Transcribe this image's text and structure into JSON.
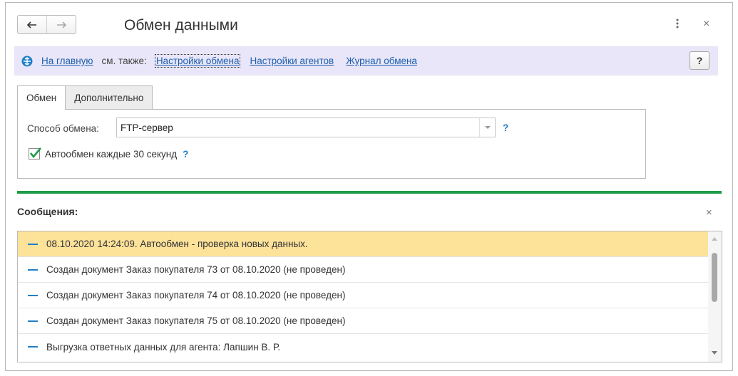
{
  "header": {
    "title": "Обмен данными",
    "back_icon": "arrow-left-icon",
    "forward_icon": "arrow-right-icon",
    "more_icon": "vertical-dots-icon",
    "close_icon": "close-icon",
    "close_glyph": "×"
  },
  "command_bar": {
    "background": "#e8e6f8",
    "home_icon": "home-icon",
    "home_link": "На главную",
    "see_also": "см. также:",
    "links": [
      "Настройки обмена",
      "Настройки агентов",
      "Журнал обмена"
    ],
    "help_label": "?"
  },
  "tabs": [
    {
      "label": "Обмен",
      "active": true
    },
    {
      "label": "Дополнительно",
      "active": false
    }
  ],
  "form": {
    "exchange_method_label": "Способ обмена:",
    "exchange_method_value": "FTP-сервер",
    "help_mark": "?",
    "auto_exchange_label": "Автообмен каждые 30 секунд",
    "auto_exchange_checked": true
  },
  "accent_color": "#1a9c48",
  "messages": {
    "title": "Сообщения:",
    "close_glyph": "×",
    "selected_color": "#fde29a",
    "items": [
      "08.10.2020 14:24:09. Автообмен - проверка новых данных.",
      "Создан документ Заказ покупателя 73 от 08.10.2020 (не проведен)",
      "Создан документ Заказ покупателя 74 от 08.10.2020 (не проведен)",
      "Создан документ Заказ покупателя 75 от 08.10.2020 (не проведен)",
      "Выгрузка ответных данных для агента: Лапшин В. Р."
    ],
    "selected_index": 0
  }
}
